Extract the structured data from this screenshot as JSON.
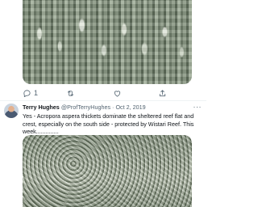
{
  "first_tweet": {
    "actions": {
      "reply_count": "1",
      "retweet_count": "",
      "like_count": "",
      "share_count": ""
    }
  },
  "second_tweet": {
    "author_name": "Terry Hughes",
    "author_handle": "@ProfTerryHughes",
    "separator": "·",
    "date": "Oct 2, 2019",
    "more_label": "···",
    "text": "Yes - Acropora aspera thickets dominate the sheltered reef flat and crest, especially on the south side - protected by Wistari Reef. This week.............."
  }
}
